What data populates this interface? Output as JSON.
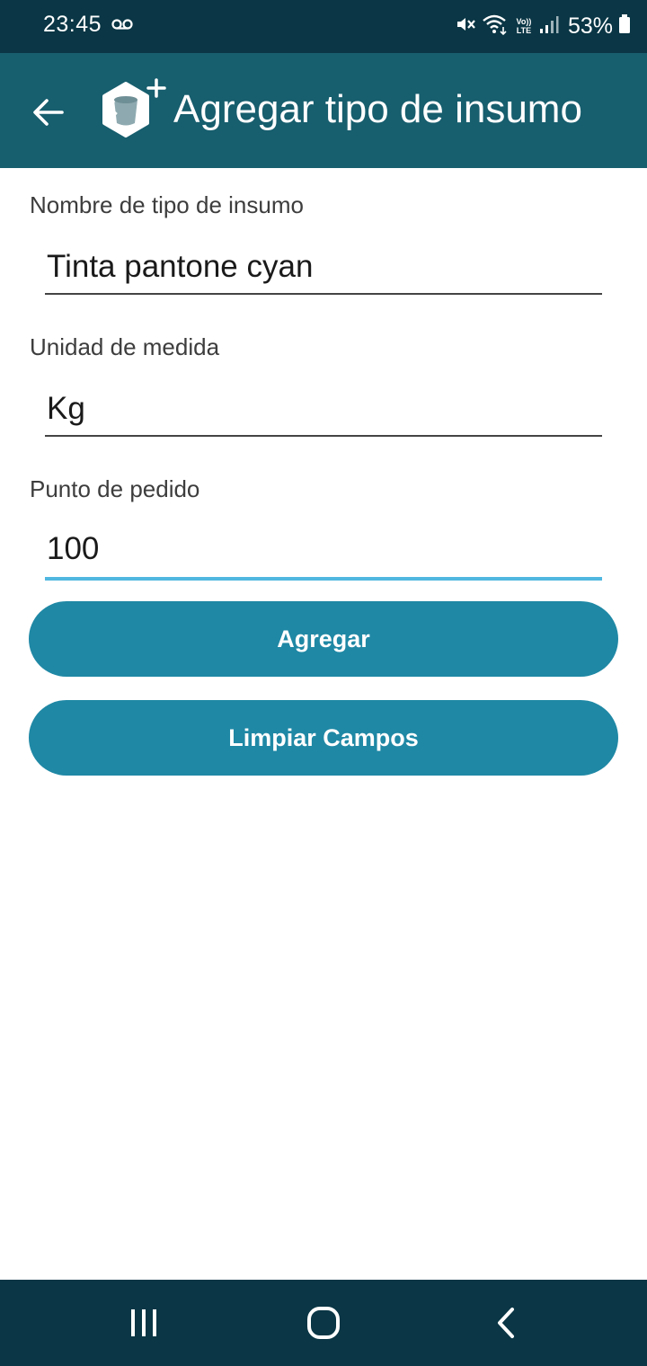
{
  "status_bar": {
    "time": "23:45",
    "volte_top": "Vo))",
    "volte_bottom": "LTE",
    "battery": "53%"
  },
  "app_bar": {
    "title": "Agregar tipo de insumo"
  },
  "form": {
    "name": {
      "label": "Nombre de tipo de insumo",
      "value": "Tinta pantone cyan"
    },
    "unit": {
      "label": "Unidad de medida",
      "value": "Kg"
    },
    "reorder_point": {
      "label": "Punto de pedido",
      "value": "100"
    }
  },
  "buttons": {
    "add": "Agregar",
    "clear": "Limpiar Campos"
  },
  "colors": {
    "status_bar": "#0a3645",
    "app_bar": "#175e6e",
    "button": "#1f88a5",
    "focus_underline": "#4fb7e0"
  },
  "icons": {
    "back": "arrow-left-icon",
    "logo": "bucket-plus-icon",
    "voicemail": "voicemail-icon",
    "mute": "vibrate-mute-icon",
    "wifi": "wifi-icon",
    "signal": "signal-icon",
    "battery": "battery-icon",
    "recents": "recent-apps-icon",
    "home": "home-icon",
    "nav_back": "chevron-left-icon"
  }
}
